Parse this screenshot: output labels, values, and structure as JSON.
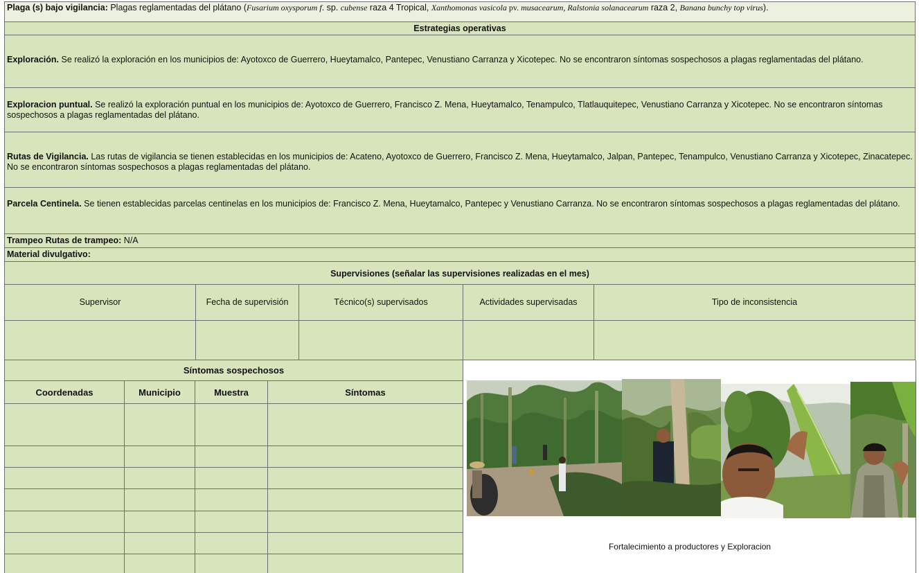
{
  "header": {
    "plaga_label": "Plaga (s) bajo vigilancia:",
    "plaga_text_1": " Plagas reglamentadas del plátano  (",
    "plaga_i_1": "Fusarium oxysporum f",
    "plaga_text_2": ". sp. ",
    "plaga_i_2": "cubense",
    "plaga_text_3": "  raza 4 Tropical, ",
    "plaga_i_3": "Xanthomonas vasicola",
    "plaga_text_4": "  pv. ",
    "plaga_i_4": "musacearum, Ralstonia solanacearum",
    "plaga_text_5": "  raza 2, ",
    "plaga_i_5": "Banana bunchy top virus",
    "plaga_text_6": ")."
  },
  "estrategias_title": "Estrategias operativas",
  "exploracion": {
    "label": "Exploración.",
    "text": " Se realizó la exploración en los municipios de: Ayotoxco de Guerrero, Hueytamalco, Pantepec, Venustiano Carranza y Xicotepec. No se encontraron síntomas sospechosos a plagas reglamentadas del plátano."
  },
  "exploracion_puntual": {
    "label": "Exploracion puntual.",
    "text": " Se realizó la exploración puntual en los municipios de: Ayotoxco de Guerrero, Francisco Z. Mena, Hueytamalco, Tenampulco, Tlatlauquitepec, Venustiano Carranza y Xicotepec. No se encontraron síntomas sospechosos a plagas reglamentadas del plátano."
  },
  "rutas": {
    "label": "Rutas de Vigilancia.",
    "text": " Las rutas de vigilancia se tienen establecidas en los municipios de: Acateno, Ayotoxco de Guerrero, Francisco Z. Mena, Hueytamalco, Jalpan, Pantepec,  Tenampulco, Venustiano Carranza y Xicotepec, Zinacatepec. No se encontraron síntomas sospechosos a plagas reglamentadas del plátano."
  },
  "parcela": {
    "label": "Parcela Centinela.",
    "text": "  Se tienen establecidas parcelas centinelas en los municipios de: Francisco Z. Mena, Hueytamalco, Pantepec y Venustiano Carranza. No se encontraron síntomas sospechosos a plagas reglamentadas del plátano."
  },
  "trampeo": {
    "label": "Trampeo Rutas de trampeo:",
    "value": " N/A"
  },
  "material": {
    "label": "Material  divulgativo:"
  },
  "supervisiones": {
    "title": "Supervisiones (señalar las supervisiones realizadas en el mes)",
    "headers": [
      "Supervisor",
      "Fecha de supervisión",
      "Técnico(s) supervisados",
      "Actividades supervisadas",
      "Tipo de inconsistencia"
    ]
  },
  "sintomas": {
    "title": "Síntomas sospechosos",
    "headers": [
      "Coordenadas",
      "Municipio",
      "Muestra",
      "Síntomas"
    ]
  },
  "photos": {
    "caption": "Fortalecimiento a productores y Exploracion",
    "items": [
      "photo-farm-visit",
      "photo-technician-banana",
      "photo-man-leaf",
      "photo-man-vest"
    ]
  }
}
